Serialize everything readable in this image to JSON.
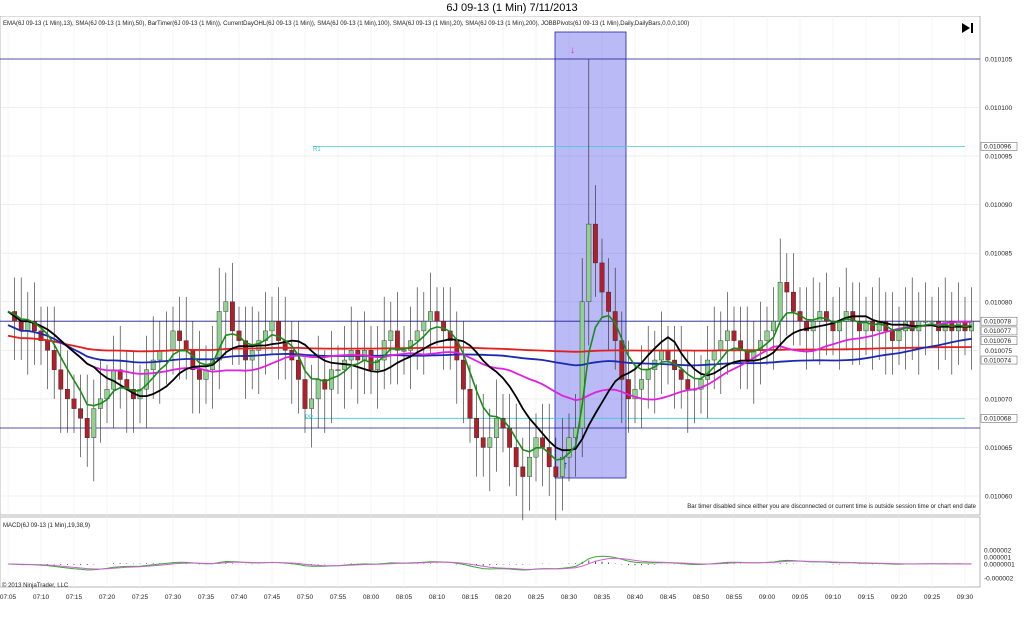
{
  "window": {
    "title": "6J 09-13 (1 Min)  7/11/2013"
  },
  "price_panel": {
    "indicator_caption": "EMA(6J 09-13 (1 Min),13), SMA(6J 09-13 (1 Min),50), BarTimer(6J 09-13 (1 Min)), CurrentDayOHL(6J 09-13 (1 Min)), SMA(6J 09-13 (1 Min),100), SMA(6J 09-13 (1 Min),20), SMA(6J 09-13 (1 Min),200), JOBBPivots(6J 09-13 (1 Min),Daily,DailyBars,0,0,0,100)",
    "bar_timer_message": "Bar timer disabled since either you are disconnected or current time is outside session time or chart end date",
    "r1_label": "R1",
    "pp_label": "PP",
    "price_ticks": [
      "0.010105",
      "0.010100",
      "0.010095",
      "0.010090",
      "0.010085",
      "0.010080",
      "0.010075",
      "0.010070",
      "0.010065",
      "0.010060"
    ],
    "price_markers": [
      "0.010096",
      "0.010078",
      "0.010077",
      "0.010076",
      "0.010074",
      "0.010068"
    ],
    "go_to_end_icon": "skip-to-end-icon"
  },
  "macd_panel": {
    "caption": "MACD(6J 09-13 (1 Min),19,38,9)",
    "ticks": [
      "0.000002",
      "0.000001",
      "0.0000001",
      "-0.000002"
    ]
  },
  "copyright": "© 2013 NinjaTrader, LLC",
  "time_axis": [
    "07:05",
    "07:10",
    "07:15",
    "07:20",
    "07:25",
    "07:30",
    "07:35",
    "07:40",
    "07:45",
    "07:50",
    "07:55",
    "08:00",
    "08:05",
    "08:10",
    "08:15",
    "08:20",
    "08:25",
    "08:30",
    "08:35",
    "08:40",
    "08:45",
    "08:50",
    "08:55",
    "09:00",
    "09:05",
    "09:10",
    "09:15",
    "09:20",
    "09:25",
    "09:30"
  ],
  "colors": {
    "up_bar": "#90d090",
    "down_bar": "#b0202a",
    "sma50": "#e020e0",
    "sma100": "#1a2ab0",
    "sma200": "#e02020",
    "ema13": "#1a8a1a",
    "sma20": "#000000",
    "pivot_line": "#40c8d8",
    "highlight": "#6666ee"
  },
  "chart_data": {
    "type": "candlestick",
    "symbol": "6J 09-13 (1 Min)",
    "date": "7/11/2013",
    "y_range": [
      0.010059,
      0.010108
    ],
    "x_range": [
      "07:04",
      "09:33"
    ],
    "levels": {
      "session_high": 0.010105,
      "r1": 0.010096,
      "current": 0.010078,
      "pp": 0.010068,
      "session_low": 0.010067
    }
  }
}
